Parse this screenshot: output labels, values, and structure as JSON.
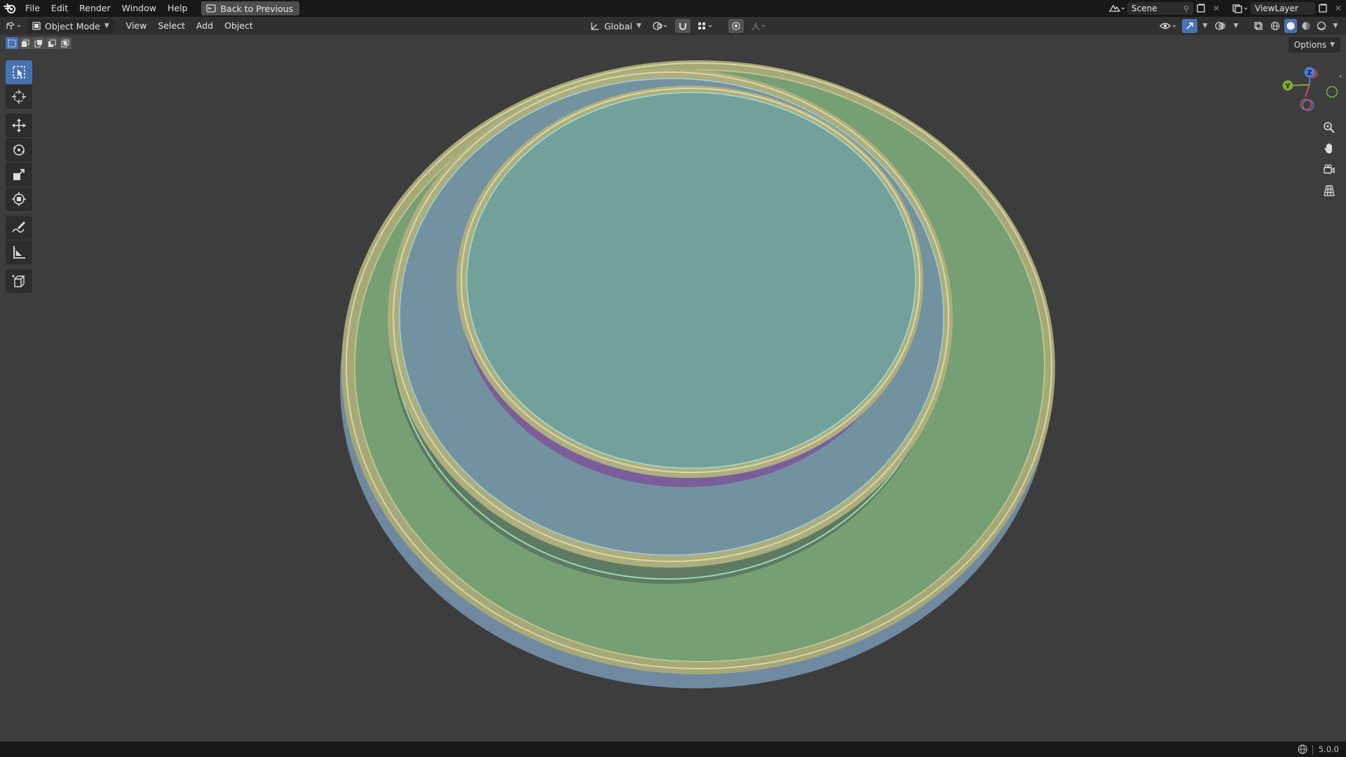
{
  "menubar": {
    "items": [
      "File",
      "Edit",
      "Render",
      "Window",
      "Help"
    ],
    "back_button": "Back to Previous",
    "scene_label": "Scene",
    "view_layer_label": "ViewLayer"
  },
  "header": {
    "mode": "Object Mode",
    "menus": [
      "View",
      "Select",
      "Add",
      "Object"
    ],
    "transform_orientation": "Global",
    "options_label": "Options"
  },
  "gizmo": {
    "x": "X",
    "y": "Y",
    "z": "Z"
  },
  "toolbar": {
    "tools": [
      "select-box",
      "cursor",
      "move",
      "rotate",
      "scale",
      "transform",
      "annotate",
      "measure",
      "add-cube"
    ],
    "active": "select-box"
  },
  "statusbar": {
    "version": "5.0.0"
  },
  "colors": {
    "accent": "#4772b3",
    "viewport_bg": "#3d3d3d",
    "ring_outer_green": "#779c70",
    "ring_middle_blue": "#7390a0",
    "disc_inner_teal": "#72a09a",
    "rim_yellow": "#b4b482",
    "side_purple": "#7a5e9a"
  }
}
